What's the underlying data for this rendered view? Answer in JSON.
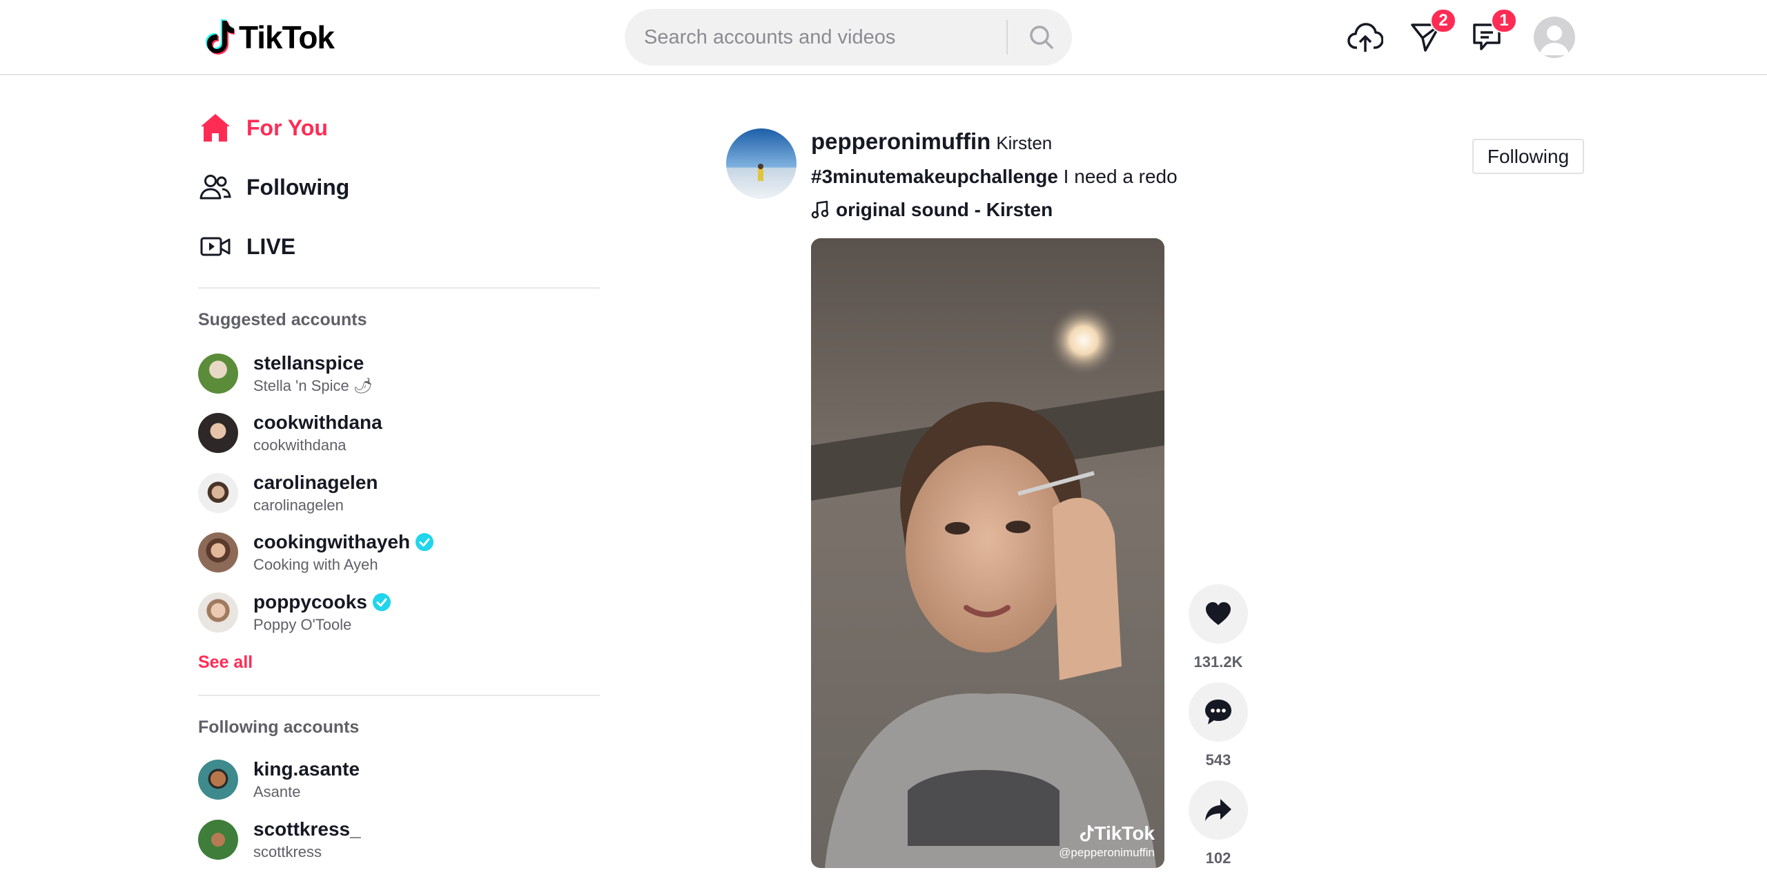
{
  "header": {
    "logo_text": "TikTok",
    "search_placeholder": "Search accounts and videos",
    "messages_badge": "2",
    "inbox_badge": "1"
  },
  "sidebar": {
    "nav": [
      {
        "label": "For You",
        "icon": "home-icon",
        "active": true
      },
      {
        "label": "Following",
        "icon": "people-icon",
        "active": false
      },
      {
        "label": "LIVE",
        "icon": "live-camera-icon",
        "active": false
      }
    ],
    "suggested_title": "Suggested accounts",
    "suggested": [
      {
        "username": "stellanspice",
        "nickname": "Stella 'n Spice 🌶",
        "verified": false
      },
      {
        "username": "cookwithdana",
        "nickname": "cookwithdana",
        "verified": false
      },
      {
        "username": "carolinagelen",
        "nickname": "carolinagelen",
        "verified": false
      },
      {
        "username": "cookingwithayeh",
        "nickname": "Cooking with Ayeh",
        "verified": true
      },
      {
        "username": "poppycooks",
        "nickname": "Poppy O'Toole",
        "verified": true
      }
    ],
    "see_all": "See all",
    "following_title": "Following accounts",
    "following": [
      {
        "username": "king.asante",
        "nickname": "Asante"
      },
      {
        "username": "scottkress_",
        "nickname": "scottkress"
      }
    ]
  },
  "post": {
    "username": "pepperonimuffin",
    "nickname": "Kirsten",
    "hashtag": "#3minutemakeupchallenge",
    "caption": " I need a redo",
    "sound": "original sound - Kirsten",
    "follow_label": "Following",
    "watermark_logo": "TikTok",
    "watermark_user": "@pepperonimuffin",
    "likes": "131.2K",
    "comments": "543",
    "shares": "102"
  },
  "colors": {
    "accent": "#fe2c55",
    "verified": "#20d5ec",
    "text": "#161823",
    "secondary": "#5f6067"
  }
}
